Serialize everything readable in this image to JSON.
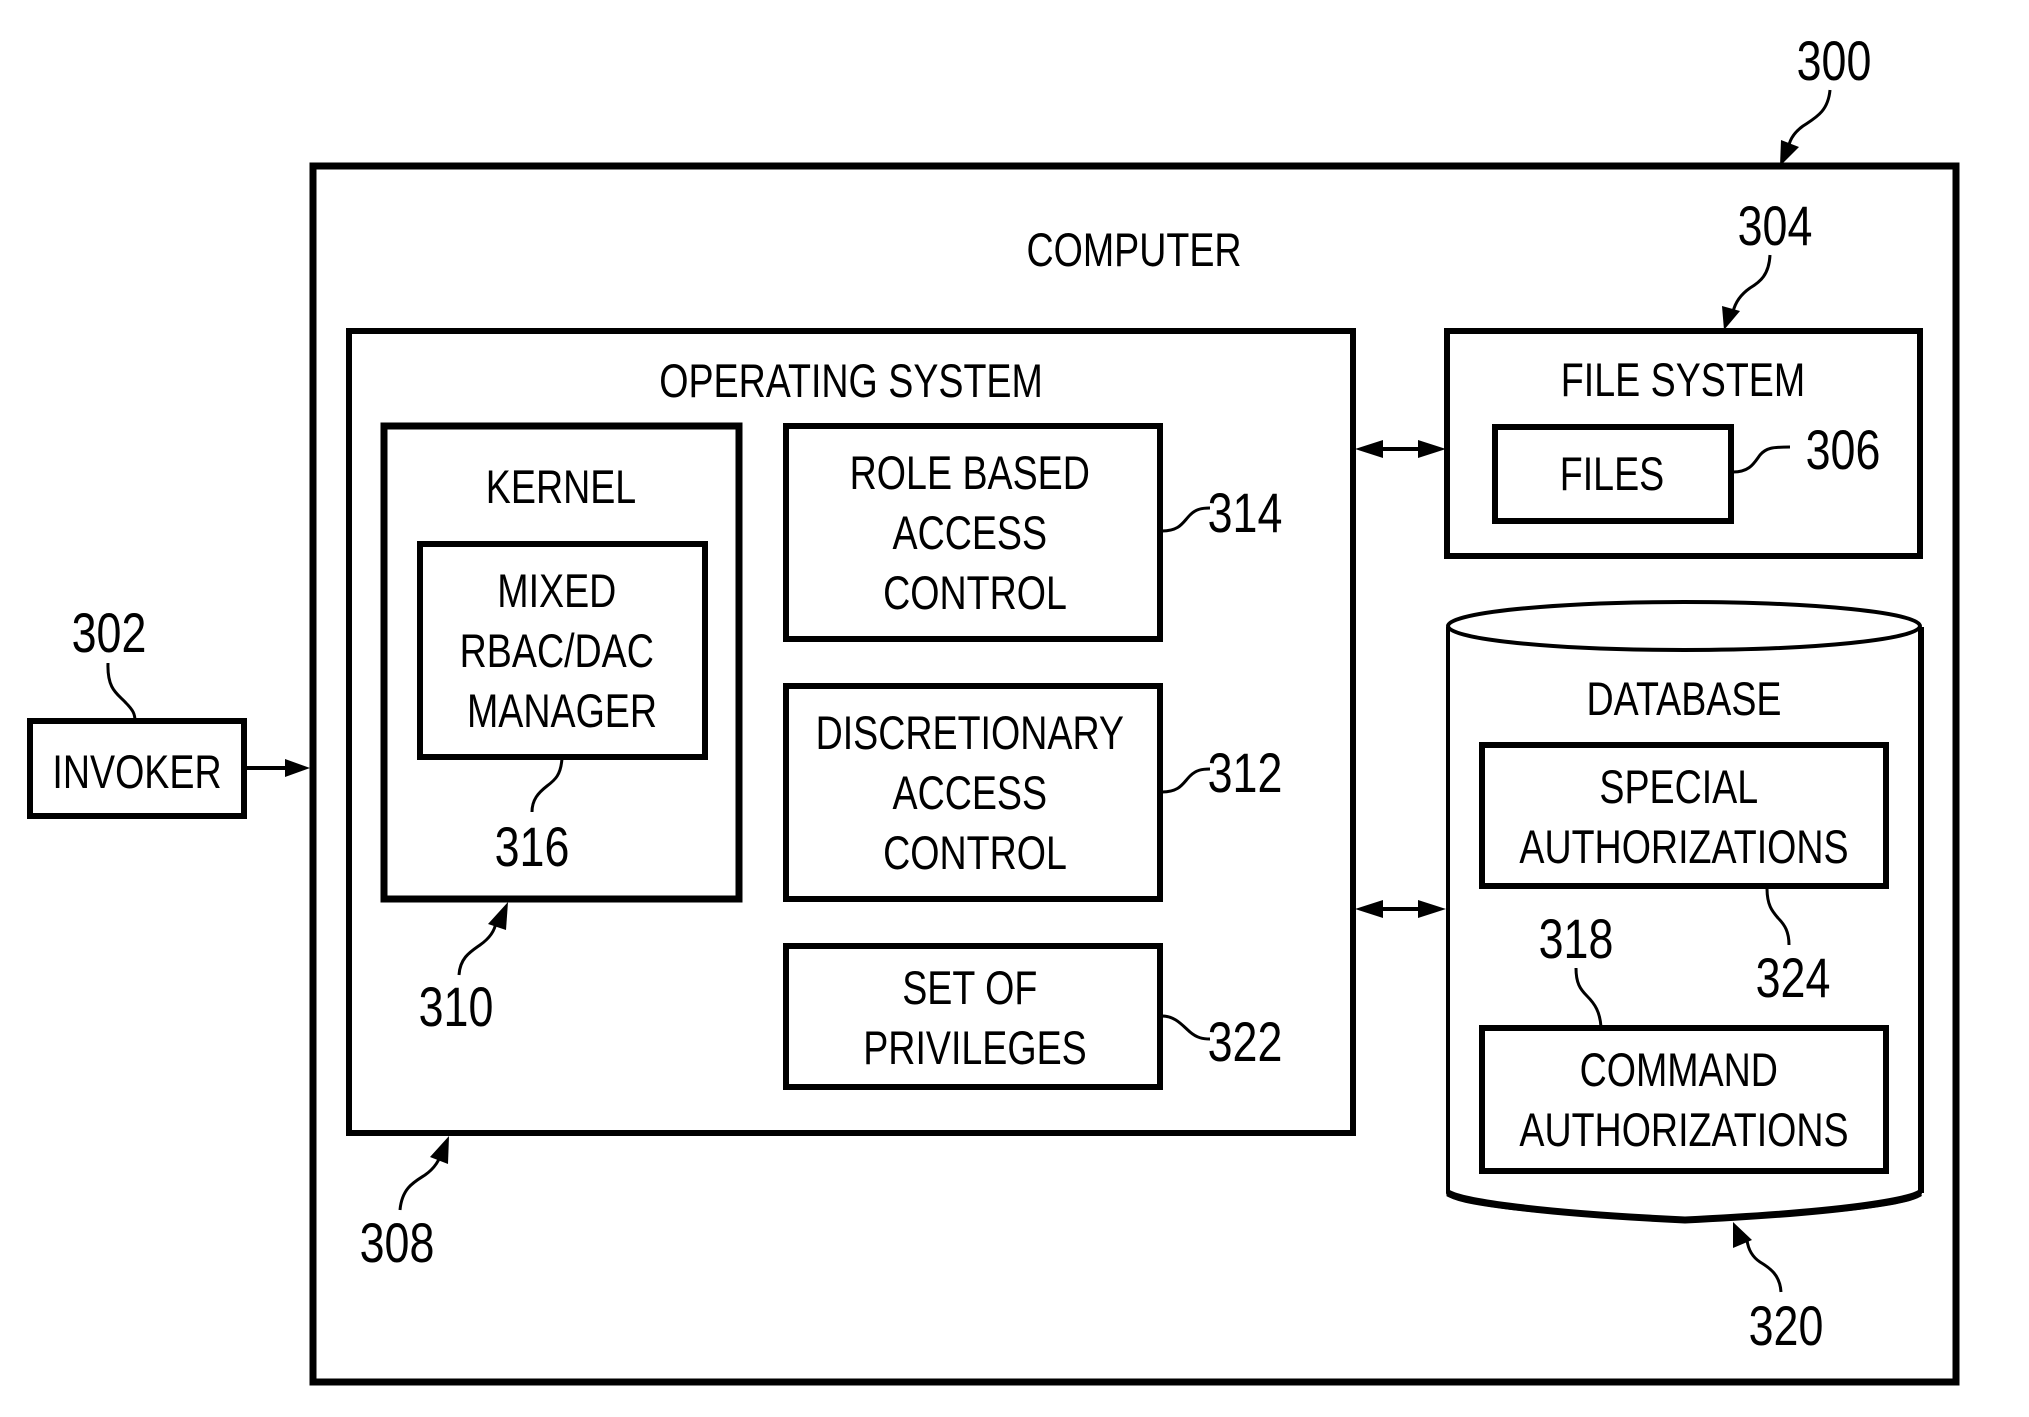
{
  "figure": {
    "number": "300",
    "computer": {
      "label": "COMPUTER",
      "ref": "300"
    },
    "invoker": {
      "label": "INVOKER",
      "ref": "302"
    },
    "operating_system": {
      "label": "OPERATING SYSTEM",
      "ref": "308",
      "kernel": {
        "label": "KERNEL",
        "ref": "310",
        "manager": {
          "lines": [
            "MIXED",
            "RBAC/DAC",
            "MANAGER"
          ],
          "ref": "316"
        }
      },
      "rbac": {
        "lines": [
          "ROLE BASED",
          "ACCESS",
          "CONTROL"
        ],
        "ref": "314"
      },
      "dac": {
        "lines": [
          "DISCRETIONARY",
          "ACCESS",
          "CONTROL"
        ],
        "ref": "312"
      },
      "privileges": {
        "lines": [
          "SET OF",
          "PRIVILEGES"
        ],
        "ref": "322"
      }
    },
    "file_system": {
      "label": "FILE SYSTEM",
      "ref": "304",
      "files": {
        "label": "FILES",
        "ref": "306"
      }
    },
    "database": {
      "label": "DATABASE",
      "ref": "320",
      "special_authorizations": {
        "lines": [
          "SPECIAL",
          "AUTHORIZATIONS"
        ],
        "ref": "324"
      },
      "command_authorizations": {
        "lines": [
          "COMMAND",
          "AUTHORIZATIONS"
        ],
        "ref": "318"
      }
    },
    "connections": [
      {
        "from": "invoker",
        "to": "computer",
        "type": "one-way"
      },
      {
        "from": "operating_system",
        "to": "file_system",
        "type": "two-way"
      },
      {
        "from": "operating_system",
        "to": "database",
        "type": "two-way"
      }
    ]
  }
}
